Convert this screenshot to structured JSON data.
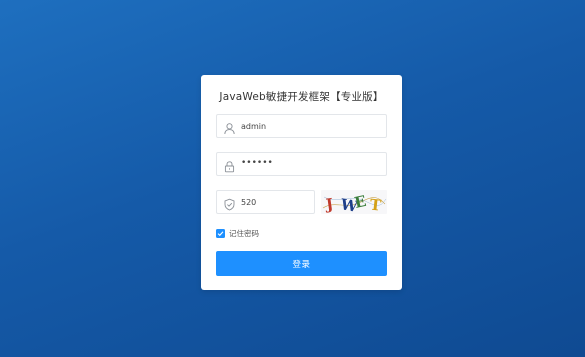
{
  "login_card": {
    "title": "JavaWeb敏捷开发框架【专业版】",
    "username": {
      "value": "admin",
      "placeholder": "",
      "icon": "user-icon"
    },
    "password": {
      "value": "123456",
      "placeholder": "",
      "icon": "lock-icon"
    },
    "captcha_input": {
      "value": "520",
      "placeholder": "",
      "icon": "shield-icon"
    },
    "captcha_image": {
      "text": "JWET",
      "colors": [
        "#c0392b",
        "#1f3f8a",
        "#3a7d3a",
        "#d4a017"
      ]
    },
    "remember": {
      "label": "记住密码",
      "checked": true
    },
    "login_button": {
      "label": "登录"
    }
  },
  "colors": {
    "background_top": "#1e6fbf",
    "background_bottom": "#0f4a92",
    "accent": "#1e90ff",
    "card": "#ffffff"
  }
}
